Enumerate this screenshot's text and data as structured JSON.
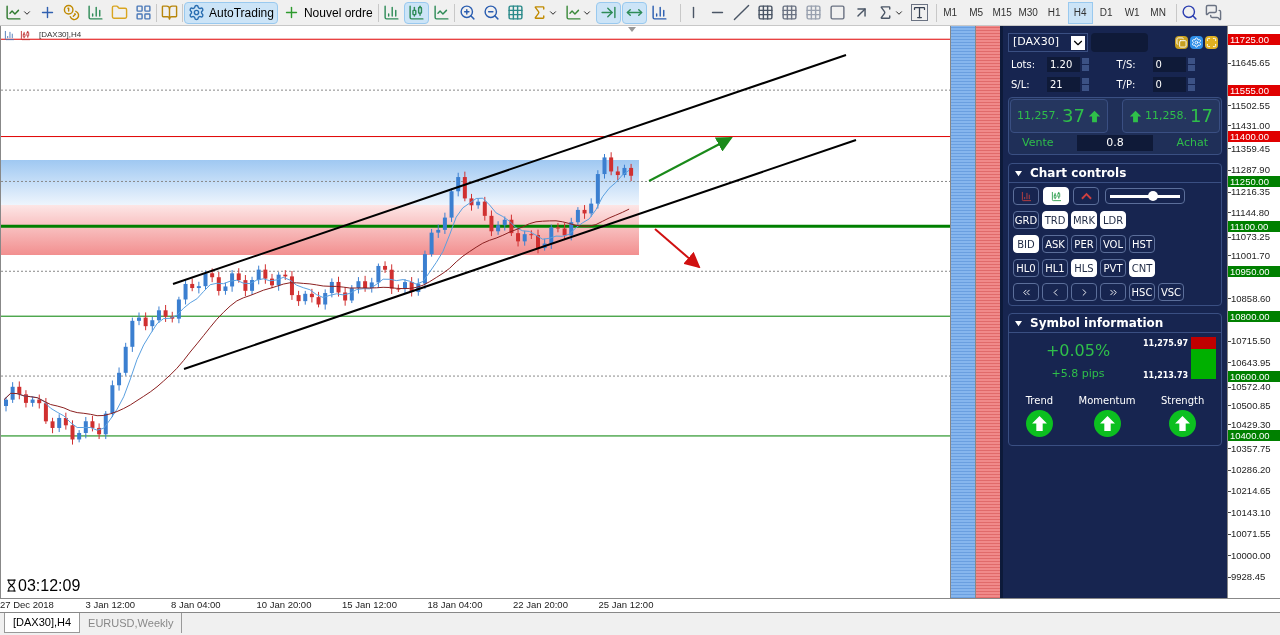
{
  "toolbar": {
    "buttons": [
      {
        "label": "AutoTrading",
        "selected": true
      },
      {
        "label": "Nouvel ordre",
        "selected": false
      }
    ],
    "timeframes": [
      {
        "label": "M1",
        "selected": false
      },
      {
        "label": "M5",
        "selected": false
      },
      {
        "label": "M15",
        "selected": false
      },
      {
        "label": "M30",
        "selected": false
      },
      {
        "label": "H1",
        "selected": false
      },
      {
        "label": "H4",
        "selected": true
      },
      {
        "label": "D1",
        "selected": false
      },
      {
        "label": "W1",
        "selected": false
      },
      {
        "label": "MN",
        "selected": false
      }
    ]
  },
  "chart": {
    "title": "[DAX30],H4",
    "countdown": "03:12:09"
  },
  "price_axis": {
    "labels": [
      "11645.65",
      "11502.55",
      "11431.00",
      "11359.45",
      "11287.90",
      "11216.35",
      "11144.80",
      "11073.25",
      "11001.70",
      "10858.60",
      "10715.50",
      "10643.95",
      "10572.40",
      "10500.85",
      "10429.30",
      "10357.75",
      "10286.20",
      "10214.65",
      "10143.10",
      "10071.55",
      "10000.00",
      "9928.45"
    ],
    "level_tags": [
      {
        "text": "11725.00",
        "color": "#e00000",
        "kind": "solid"
      },
      {
        "text": "11555.00",
        "color": "#e00000",
        "kind": "dotted"
      },
      {
        "text": "11400.00",
        "color": "#e00000",
        "kind": "solid"
      },
      {
        "text": "11250.00",
        "color": "#008000",
        "kind": "dotted"
      },
      {
        "text": "11100.00",
        "color": "#008000",
        "kind": "thick"
      },
      {
        "text": "10950.00",
        "color": "#008000",
        "kind": "dotted"
      },
      {
        "text": "10800.00",
        "color": "#008000",
        "kind": "solid"
      },
      {
        "text": "10600.00",
        "color": "#008000",
        "kind": "dotted"
      },
      {
        "text": "10400.00",
        "color": "#008000",
        "kind": "solid"
      }
    ]
  },
  "time_axis": {
    "labels": [
      "27 Dec 2018",
      "3 Jan 12:00",
      "8 Jan 04:00",
      "10 Jan 20:00",
      "15 Jan 12:00",
      "18 Jan 04:00",
      "22 Jan 20:00",
      "25 Jan 12:00"
    ]
  },
  "trade_panel": {
    "symbol": "[DAX30]",
    "fields": [
      {
        "label": "Lots:",
        "value": "1.20"
      },
      {
        "label": "T/S:",
        "value": "0"
      },
      {
        "label": "S/L:",
        "value": "21"
      },
      {
        "label": "T/P:",
        "value": "0"
      }
    ],
    "sell": {
      "price_small": "11,257.",
      "price_big": "37",
      "label": "Vente",
      "rising": true
    },
    "buy": {
      "price_small": "11,258.",
      "price_big": "17",
      "label": "Achat",
      "rising": true
    },
    "spread": "0.8"
  },
  "chart_controls": {
    "title": "Chart controls",
    "expanded": true,
    "style_buttons": [
      {
        "selected": false
      },
      {
        "selected": true
      },
      {
        "selected": false
      }
    ],
    "zoom_slider": {
      "level": 0.62
    },
    "rows": [
      [
        {
          "label": "GRD",
          "selected": false
        },
        {
          "label": "TRD",
          "selected": true
        },
        {
          "label": "MRK",
          "selected": true
        },
        {
          "label": "LDR",
          "selected": true
        }
      ],
      [
        {
          "label": "BID",
          "selected": true
        },
        {
          "label": "ASK",
          "selected": false
        },
        {
          "label": "PER",
          "selected": false
        },
        {
          "label": "VOL",
          "selected": false
        },
        {
          "label": "HST",
          "selected": false
        }
      ],
      [
        {
          "label": "HL0",
          "selected": false
        },
        {
          "label": "HL1",
          "selected": false
        },
        {
          "label": "HLS",
          "selected": true
        },
        {
          "label": "PVT",
          "selected": false
        },
        {
          "label": "CNT",
          "selected": true
        }
      ]
    ],
    "scroll_buttons": [
      {
        "label": "HSC",
        "selected": false
      },
      {
        "label": "VSC",
        "selected": false
      }
    ]
  },
  "symbol_info": {
    "title": "Symbol information",
    "expanded": true,
    "change": "+0.05%",
    "pips": "+5.8 pips",
    "high": "11,275.97",
    "low": "11,213.73",
    "indicators": [
      {
        "label": "Trend",
        "rising": true
      },
      {
        "label": "Momentum",
        "rising": true
      },
      {
        "label": "Strength",
        "rising": true
      }
    ]
  },
  "tabs": [
    {
      "label": "[DAX30],H4",
      "selected": true
    },
    {
      "label": "EURUSD,Weekly",
      "selected": false
    }
  ]
}
